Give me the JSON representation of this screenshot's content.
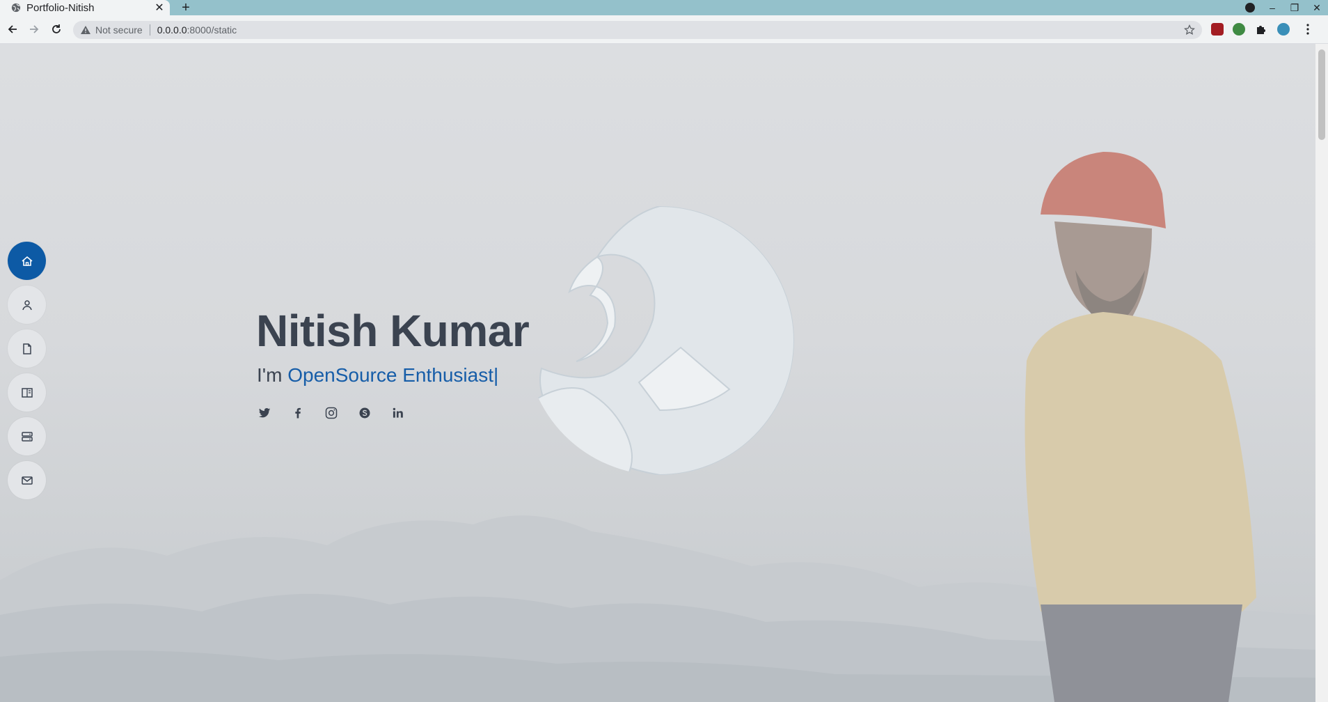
{
  "browser": {
    "tab_title": "Portfolio-Nitish",
    "tab_close": "✕",
    "new_tab": "+",
    "omnibox": {
      "security_text": "Not secure",
      "url_host": "0.0.0.0",
      "url_rest": ":8000/static"
    },
    "window_controls": [
      "–",
      "❐",
      "✕"
    ]
  },
  "sidebar": {
    "items": [
      {
        "name": "home",
        "icon": "home-icon",
        "active": true
      },
      {
        "name": "about",
        "icon": "person-icon",
        "active": false
      },
      {
        "name": "resume",
        "icon": "file-icon",
        "active": false
      },
      {
        "name": "portfolio",
        "icon": "book-icon",
        "active": false
      },
      {
        "name": "services",
        "icon": "server-icon",
        "active": false
      },
      {
        "name": "contact",
        "icon": "envelope-icon",
        "active": false
      }
    ]
  },
  "hero": {
    "name": "Nitish Kumar",
    "prefix": "I'm ",
    "role": "OpenSource Enthusiast",
    "cursor": "|",
    "social": [
      "twitter-icon",
      "facebook-icon",
      "instagram-icon",
      "skype-icon",
      "linkedin-icon"
    ]
  },
  "colors": {
    "accent": "#0d5aa5",
    "text": "#3b4350",
    "role_text": "#165da8",
    "tabbar": "#94c1cb"
  }
}
